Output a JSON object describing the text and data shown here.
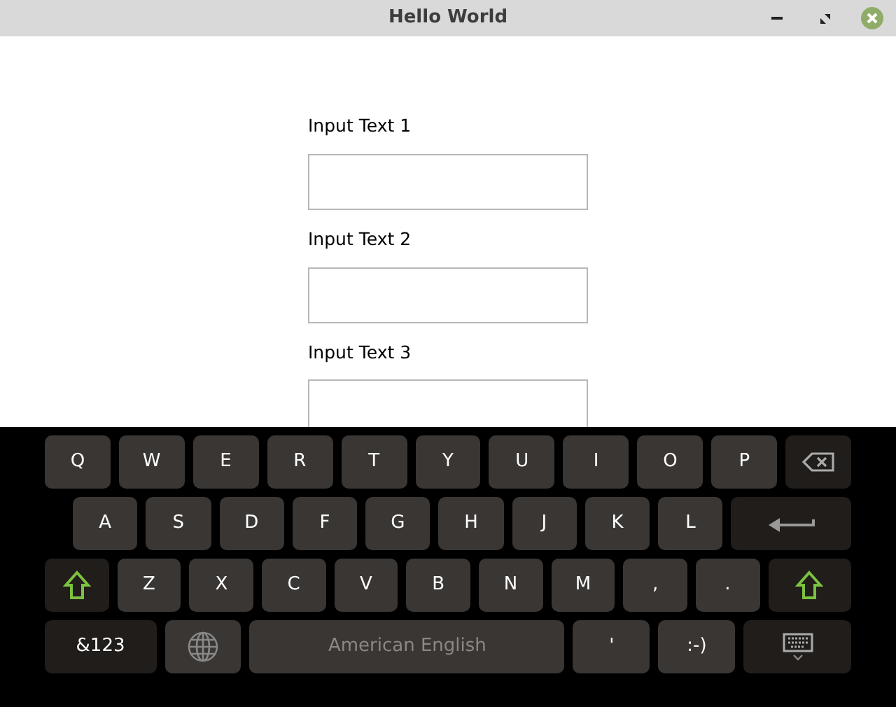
{
  "window": {
    "title": "Hello World"
  },
  "fields": [
    {
      "label": "Input Text 1"
    },
    {
      "label": "Input Text 2"
    },
    {
      "label": "Input Text 3"
    }
  ],
  "keyboard": {
    "rows": [
      {
        "keys": [
          {
            "kind": "letter",
            "label": "Q"
          },
          {
            "kind": "letter",
            "label": "W"
          },
          {
            "kind": "letter",
            "label": "E"
          },
          {
            "kind": "letter",
            "label": "R"
          },
          {
            "kind": "letter",
            "label": "T"
          },
          {
            "kind": "letter",
            "label": "Y"
          },
          {
            "kind": "letter",
            "label": "U"
          },
          {
            "kind": "letter",
            "label": "I"
          },
          {
            "kind": "letter",
            "label": "O"
          },
          {
            "kind": "letter",
            "label": "P"
          },
          {
            "kind": "backspace"
          }
        ]
      },
      {
        "keys": [
          {
            "kind": "letter",
            "label": "A"
          },
          {
            "kind": "letter",
            "label": "S"
          },
          {
            "kind": "letter",
            "label": "D"
          },
          {
            "kind": "letter",
            "label": "F"
          },
          {
            "kind": "letter",
            "label": "G"
          },
          {
            "kind": "letter",
            "label": "H"
          },
          {
            "kind": "letter",
            "label": "J"
          },
          {
            "kind": "letter",
            "label": "K"
          },
          {
            "kind": "letter",
            "label": "L"
          },
          {
            "kind": "enter"
          }
        ]
      },
      {
        "keys": [
          {
            "kind": "shift"
          },
          {
            "kind": "letter",
            "label": "Z"
          },
          {
            "kind": "letter",
            "label": "X"
          },
          {
            "kind": "letter",
            "label": "C"
          },
          {
            "kind": "letter",
            "label": "V"
          },
          {
            "kind": "letter",
            "label": "B"
          },
          {
            "kind": "letter",
            "label": "N"
          },
          {
            "kind": "letter",
            "label": "M"
          },
          {
            "kind": "letter",
            "label": ","
          },
          {
            "kind": "letter",
            "label": "."
          },
          {
            "kind": "shift"
          }
        ]
      },
      {
        "keys": [
          {
            "kind": "symbols",
            "label": "&123"
          },
          {
            "kind": "globe"
          },
          {
            "kind": "space",
            "label": "American English"
          },
          {
            "kind": "letter",
            "label": "'"
          },
          {
            "kind": "letter",
            "label": ":-)"
          },
          {
            "kind": "hide"
          }
        ]
      }
    ]
  }
}
